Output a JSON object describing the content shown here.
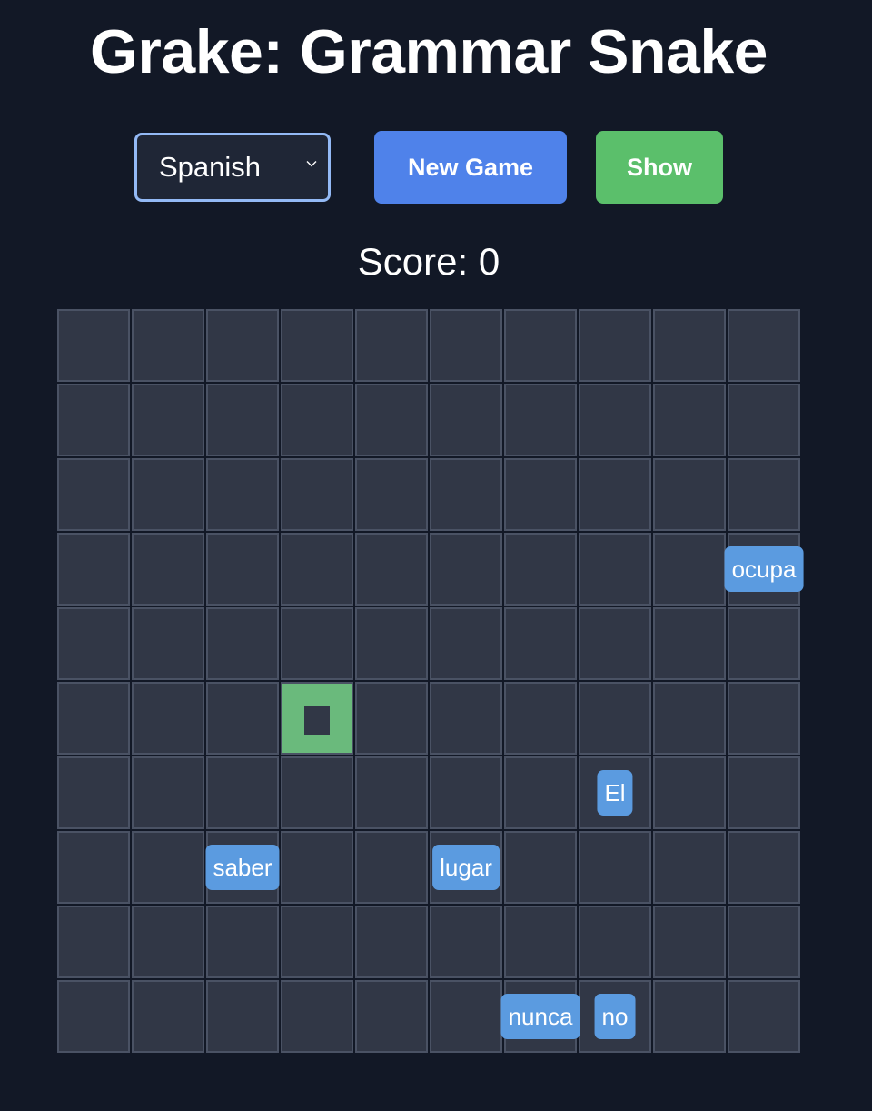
{
  "title": "Grake: Grammar Snake",
  "controls": {
    "language_selected": "Spanish",
    "new_game_label": "New Game",
    "show_label": "Show"
  },
  "score_text": "Score: 0",
  "colors": {
    "background": "#121826",
    "cell": "#313746",
    "cell_border": "#4a5264",
    "snake": "#6aba7c",
    "word_tile": "#5b9be0",
    "new_game_button": "#4f82ea",
    "show_button": "#5bbf6b",
    "select_border": "#93b9f5"
  },
  "board": {
    "rows": 10,
    "cols": 10,
    "snake": [
      {
        "row": 5,
        "col": 3
      }
    ],
    "words": [
      {
        "text": "ocupa",
        "row": 3,
        "col": 9
      },
      {
        "text": "El",
        "row": 6,
        "col": 7
      },
      {
        "text": "saber",
        "row": 7,
        "col": 2
      },
      {
        "text": "lugar",
        "row": 7,
        "col": 5
      },
      {
        "text": "nunca",
        "row": 9,
        "col": 6
      },
      {
        "text": "no",
        "row": 9,
        "col": 7
      }
    ]
  }
}
